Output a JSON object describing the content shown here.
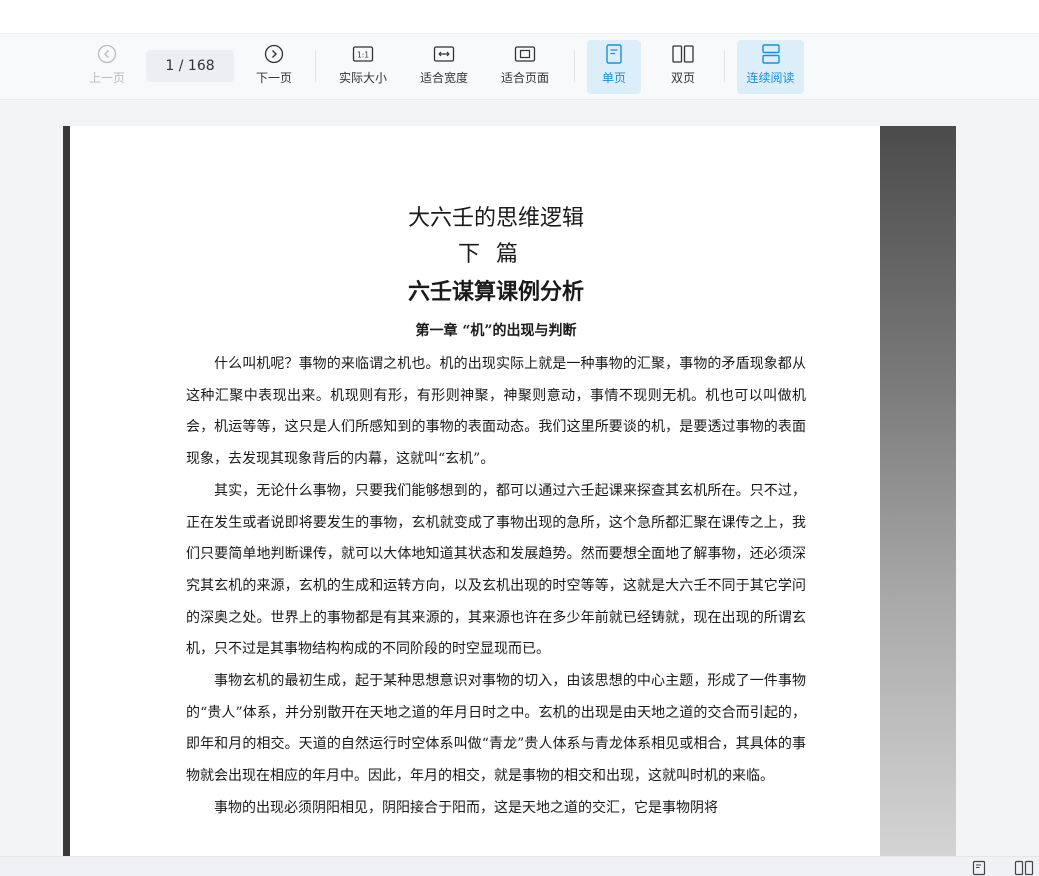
{
  "toolbar": {
    "prev_label": "上一页",
    "page_current": "1",
    "page_total": "168",
    "next_label": "下一页",
    "actual_size_label": "实际大小",
    "actual_size_icon_text": "1:1",
    "fit_width_label": "适合宽度",
    "fit_page_label": "适合页面",
    "single_page_label": "单页",
    "double_page_label": "双页",
    "continuous_label": "连续阅读"
  },
  "document": {
    "title1": "大六壬的思维逻辑",
    "title2": "下篇",
    "title3": "六壬谋算课例分析",
    "chapter": "第一章 “机”的出现与判断",
    "paragraphs": [
      "什么叫机呢？事物的来临谓之机也。机的出现实际上就是一种事物的汇聚，事物的矛盾现象都从这种汇聚中表现出来。机现则有形，有形则神聚，神聚则意动，事情不现则无机。机也可以叫做机会，机运等等，这只是人们所感知到的事物的表面动态。我们这里所要谈的机，是要透过事物的表面现象，去发现其现象背后的内幕，这就叫“玄机”。",
      "其实，无论什么事物，只要我们能够想到的，都可以通过六壬起课来探查其玄机所在。只不过，正在发生或者说即将要发生的事物，玄机就变成了事物出现的急所，这个急所都汇聚在课传之上，我们只要简单地判断课传，就可以大体地知道其状态和发展趋势。然而要想全面地了解事物，还必须深究其玄机的来源，玄机的生成和运转方向，以及玄机出现的时空等等，这就是大六壬不同于其它学问的深奥之处。世界上的事物都是有其来源的，其来源也许在多少年前就已经铸就，现在出现的所谓玄机，只不过是其事物结构构成的不同阶段的时空显现而已。",
      "事物玄机的最初生成，起于某种思想意识对事物的切入，由该思想的中心主题，形成了一件事物的“贵人”体系，并分别散开在天地之道的年月日时之中。玄机的出现是由天地之道的交合而引起的，即年和月的相交。天道的自然运行时空体系叫做“青龙”贵人体系与青龙体系相见或相合，其具体的事物就会出现在相应的年月中。因此，年月的相交，就是事物的相交和出现，这就叫时机的来临。",
      "事物的出现必须阴阳相见，阴阳接合于阳而，这是天地之道的交汇，它是事物阴将"
    ]
  },
  "statusbar": {
    "single_icon": "single-page-icon",
    "double_icon": "double-page-icon"
  },
  "colors": {
    "accent": "#1a8fd6",
    "active_bg": "#dbeefa",
    "disabled": "#b8bcc4"
  }
}
